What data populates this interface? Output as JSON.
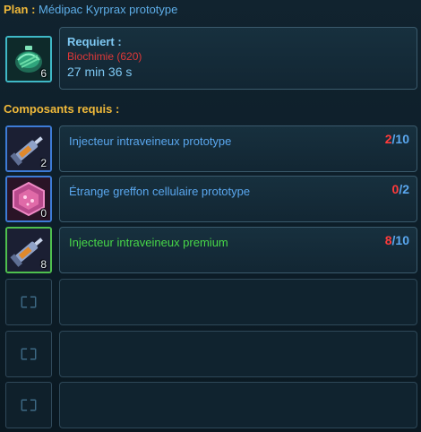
{
  "header": {
    "label": "Plan :",
    "item_name": "Médipac Kyrprax prototype"
  },
  "plan": {
    "quantity": "6",
    "requires_label": "Requiert :",
    "skill": "Biochimie (620)",
    "time": "27 min 36 s"
  },
  "components_title": "Composants requis :",
  "components": [
    {
      "name": "Injecteur intraveineux prototype",
      "have": "2",
      "sep": "/",
      "need": "10",
      "stack": "2",
      "icon": "syringe-icon",
      "quality_color": "#3d7bd6",
      "name_color": "#5aa7ee"
    },
    {
      "name": "Étrange greffon cellulaire prototype",
      "have": "0",
      "sep": "/",
      "need": "2",
      "stack": "0",
      "icon": "cellular-graft-icon",
      "quality_color": "#3d7bd6",
      "name_color": "#5aa7ee"
    },
    {
      "name": "Injecteur intraveineux premium",
      "have": "8",
      "sep": "/",
      "need": "10",
      "stack": "8",
      "icon": "syringe-icon",
      "quality_color": "#4ec04e",
      "name_color": "#48d848"
    }
  ],
  "empty_slots": 3
}
